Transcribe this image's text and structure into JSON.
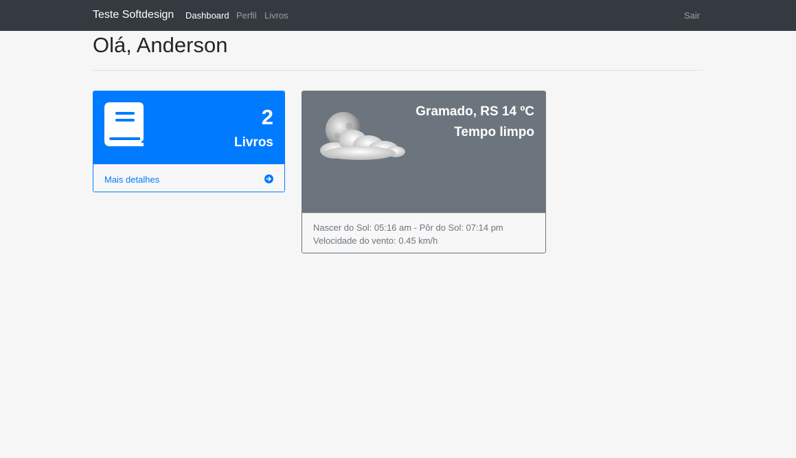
{
  "navbar": {
    "brand": "Teste Softdesign",
    "links": [
      {
        "label": "Dashboard",
        "active": true
      },
      {
        "label": "Perfil",
        "active": false
      },
      {
        "label": "Livros",
        "active": false
      }
    ],
    "logout": "Sair"
  },
  "page": {
    "greeting": "Olá, Anderson"
  },
  "books_card": {
    "icon": "book-icon",
    "count": "2",
    "label": "Livros",
    "details_link": "Mais detalhes",
    "details_icon": "arrow-circle-right-icon",
    "color": "#007bff"
  },
  "weather_card": {
    "city_temp": "Gramado, RS 14 ºC",
    "description": "Tempo limpo",
    "icon": "moon-cloud-icon",
    "sun_info": "Nascer do Sol: 05:16 am - Pôr do Sol: 07:14 pm",
    "wind_info": "Velocidade do vento: 0.45 km/h",
    "color": "#6c757d"
  }
}
